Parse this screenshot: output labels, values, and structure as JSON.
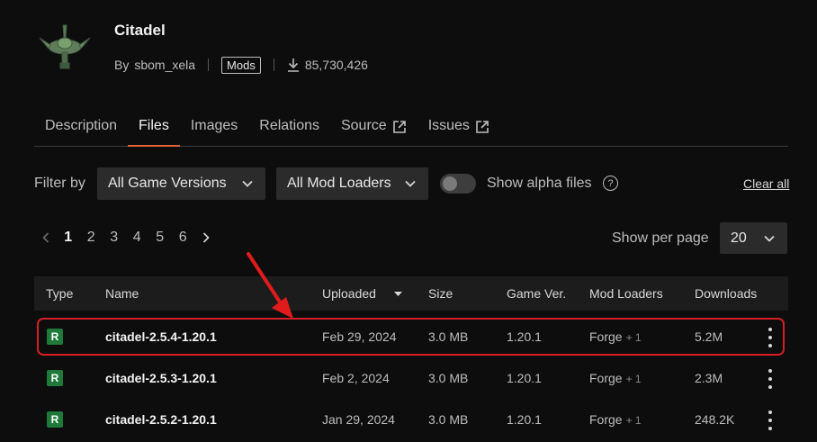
{
  "project": {
    "title": "Citadel",
    "by_label": "By",
    "author": "sbom_xela",
    "category_badge": "Mods",
    "downloads": "85,730,426"
  },
  "tabs": [
    {
      "label": "Description",
      "active": false
    },
    {
      "label": "Files",
      "active": true
    },
    {
      "label": "Images",
      "active": false
    },
    {
      "label": "Relations",
      "active": false
    },
    {
      "label": "Source",
      "active": false,
      "external": true
    },
    {
      "label": "Issues",
      "active": false,
      "external": true
    }
  ],
  "filters": {
    "label": "Filter by",
    "game_versions": "All Game Versions",
    "mod_loaders": "All Mod Loaders",
    "alpha_label": "Show alpha files",
    "alpha_enabled": false,
    "help": "?",
    "clear_all": "Clear all"
  },
  "pagination": {
    "pages": [
      "1",
      "2",
      "3",
      "4",
      "5",
      "6"
    ],
    "current": "1",
    "per_page_label": "Show per page",
    "per_page": "20"
  },
  "table": {
    "headers": {
      "type": "Type",
      "name": "Name",
      "uploaded": "Uploaded",
      "size": "Size",
      "game_ver": "Game Ver.",
      "mod_loaders": "Mod Loaders",
      "downloads": "Downloads"
    },
    "rows": [
      {
        "type": "R",
        "name": "citadel-2.5.4-1.20.1",
        "uploaded": "Feb 29, 2024",
        "size": "3.0 MB",
        "game_ver": "1.20.1",
        "loader": "Forge",
        "loader_extra": "+ 1",
        "downloads": "5.2M"
      },
      {
        "type": "R",
        "name": "citadel-2.5.3-1.20.1",
        "uploaded": "Feb 2, 2024",
        "size": "3.0 MB",
        "game_ver": "1.20.1",
        "loader": "Forge",
        "loader_extra": "+ 1",
        "downloads": "2.3M"
      },
      {
        "type": "R",
        "name": "citadel-2.5.2-1.20.1",
        "uploaded": "Jan 29, 2024",
        "size": "3.0 MB",
        "game_ver": "1.20.1",
        "loader": "Forge",
        "loader_extra": "+ 1",
        "downloads": "248.2K"
      }
    ]
  },
  "colors": {
    "accent": "#e2643a",
    "release_badge": "#1f7a3a",
    "highlight": "#d31f24"
  }
}
